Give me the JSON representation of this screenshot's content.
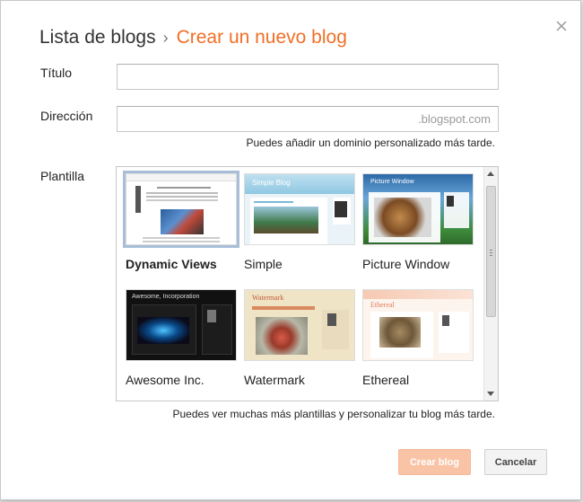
{
  "header": {
    "breadcrumb_parent": "Lista de blogs",
    "separator": "›",
    "current": "Crear un nuevo blog"
  },
  "form": {
    "title_label": "Título",
    "title_value": "",
    "address_label": "Dirección",
    "address_value": "",
    "address_suffix": ".blogspot.com",
    "address_hint": "Puedes añadir un dominio personalizado más tarde.",
    "template_label": "Plantilla",
    "template_hint": "Puedes ver muchas más plantillas y personalizar tu blog más tarde."
  },
  "templates": [
    {
      "name": "Dynamic Views",
      "selected": true
    },
    {
      "name": "Simple",
      "selected": false
    },
    {
      "name": "Picture Window",
      "selected": false
    },
    {
      "name": "Awesome Inc.",
      "selected": false
    },
    {
      "name": "Watermark",
      "selected": false
    },
    {
      "name": "Ethereal",
      "selected": false
    }
  ],
  "thumbnail_text": {
    "simple": "Simple Blog",
    "picture_window": "Picture Window",
    "awesome": "Awesome, Incorporation",
    "watermark": "Watermark",
    "ethereal": "Ethereal"
  },
  "buttons": {
    "create": "Crear blog",
    "cancel": "Cancelar"
  },
  "colors": {
    "accent": "#f06f26",
    "create_button": "#f9c4a6",
    "selection_outline": "#a8bed8"
  }
}
